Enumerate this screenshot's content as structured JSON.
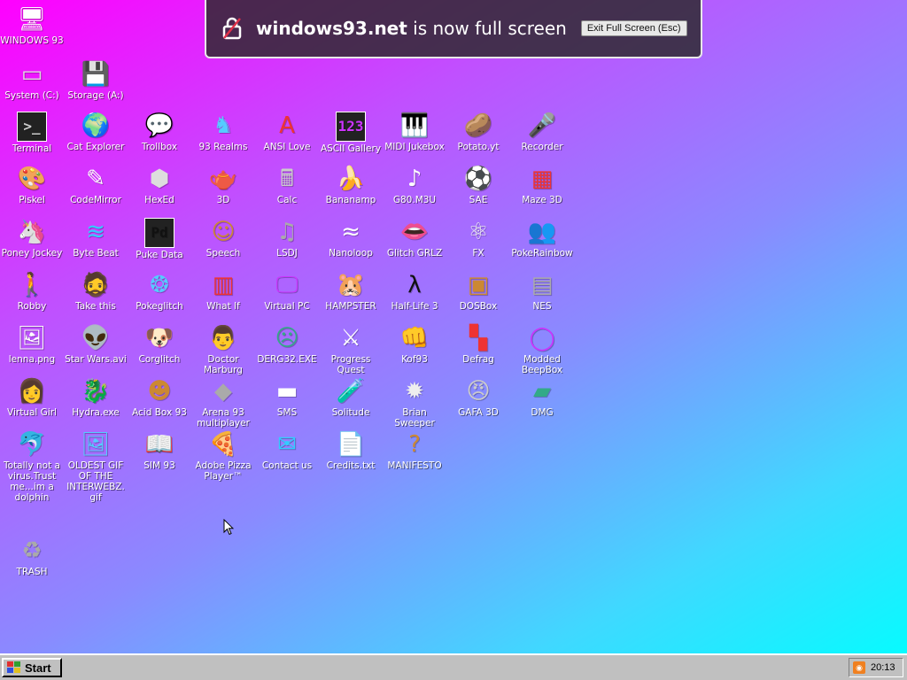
{
  "fullscreen_notice": {
    "site": "windows93.net",
    "message": " is now full screen",
    "exit_button": "Exit Full Screen (Esc)"
  },
  "taskbar": {
    "start_label": "Start",
    "clock": "20:13"
  },
  "desktop_icons": [
    {
      "label": "WINDOWS 93",
      "icon": "computer-icon",
      "glyph": "🖥"
    },
    {
      "label": "System (C:)",
      "icon": "hard-drive-icon",
      "glyph": "▭"
    },
    {
      "label": "Storage (A:)",
      "icon": "floppy-drive-icon",
      "glyph": "💾"
    },
    {
      "label": "Terminal",
      "icon": "terminal-icon",
      "glyph": ">_"
    },
    {
      "label": "Cat Explorer",
      "icon": "cat-globe-icon",
      "glyph": "🌍"
    },
    {
      "label": "Trollbox",
      "icon": "chat-bubble-icon",
      "glyph": "💬"
    },
    {
      "label": "93 Realms",
      "icon": "knight-icon",
      "glyph": "♞"
    },
    {
      "label": "ANSI Love",
      "icon": "ansi-pencil-icon",
      "glyph": "A"
    },
    {
      "label": "ASCII Gallery",
      "icon": "ascii-numbers-icon",
      "glyph": "123"
    },
    {
      "label": "MIDI Jukebox",
      "icon": "piano-keys-icon",
      "glyph": "🎹"
    },
    {
      "label": "Potato.yt",
      "icon": "potato-icon",
      "glyph": "🥔"
    },
    {
      "label": "Recorder",
      "icon": "microphone-icon",
      "glyph": "🎤"
    },
    {
      "label": "Piskel",
      "icon": "paint-palette-icon",
      "glyph": "🎨"
    },
    {
      "label": "CodeMirror",
      "icon": "code-mirror-icon",
      "glyph": "✎"
    },
    {
      "label": "HexEd",
      "icon": "cube-icon",
      "glyph": "⬢"
    },
    {
      "label": "3D",
      "icon": "teapot-icon",
      "glyph": "🫖"
    },
    {
      "label": "Calc",
      "icon": "calculator-icon",
      "glyph": "🖩"
    },
    {
      "label": "Bananamp",
      "icon": "banana-icon",
      "glyph": "🍌"
    },
    {
      "label": "G80.M3U",
      "icon": "playlist-file-icon",
      "glyph": "♪"
    },
    {
      "label": "SAE",
      "icon": "checkered-ball-icon",
      "glyph": "⚽"
    },
    {
      "label": "Maze 3D",
      "icon": "maze-icon",
      "glyph": "▦"
    },
    {
      "label": "Poney Jockey",
      "icon": "pony-icon",
      "glyph": "🦄"
    },
    {
      "label": "Byte Beat",
      "icon": "wave-icon",
      "glyph": "≋"
    },
    {
      "label": "Puke Data",
      "icon": "pd-icon",
      "glyph": "Pd"
    },
    {
      "label": "Speech",
      "icon": "face-icon",
      "glyph": "☺"
    },
    {
      "label": "LSDJ",
      "icon": "lsdj-icon",
      "glyph": "♫"
    },
    {
      "label": "Nanoloop",
      "icon": "loop-icon",
      "glyph": "≈"
    },
    {
      "label": "Glitch GRLZ",
      "icon": "lips-icon",
      "glyph": "👄"
    },
    {
      "label": "FX",
      "icon": "atom-icon",
      "glyph": "⚛"
    },
    {
      "label": "PokeRainbow",
      "icon": "characters-icon",
      "glyph": "👥"
    },
    {
      "label": "Robby",
      "icon": "stick-figure-icon",
      "glyph": "🚶"
    },
    {
      "label": "Take this",
      "icon": "pixel-man-icon",
      "glyph": "🧔"
    },
    {
      "label": "Pokeglitch",
      "icon": "glitch-icon",
      "glyph": "❂"
    },
    {
      "label": "What If",
      "icon": "grid-monitor-icon",
      "glyph": "▥"
    },
    {
      "label": "Virtual PC",
      "icon": "virtual-pc-icon",
      "glyph": "🖵"
    },
    {
      "label": "HAMPSTER",
      "icon": "hamster-icon",
      "glyph": "🐹"
    },
    {
      "label": "Half-Life 3",
      "icon": "lambda-icon",
      "glyph": "λ"
    },
    {
      "label": "DOSBox",
      "icon": "dosbox-icon",
      "glyph": "▣"
    },
    {
      "label": "NES",
      "icon": "nes-console-icon",
      "glyph": "▤"
    },
    {
      "label": "lenna.png",
      "icon": "image-file-icon",
      "glyph": "🖼"
    },
    {
      "label": "Star Wars.avi",
      "icon": "yoda-icon",
      "glyph": "👽"
    },
    {
      "label": "Corglitch",
      "icon": "corgi-icon",
      "glyph": "🐶"
    },
    {
      "label": "Doctor Marburg",
      "icon": "doctor-icon",
      "glyph": "👨"
    },
    {
      "label": "DERG32.EXE",
      "icon": "exe-face-icon",
      "glyph": "☹"
    },
    {
      "label": "Progress Quest",
      "icon": "crossed-swords-icon",
      "glyph": "⚔"
    },
    {
      "label": "Kof93",
      "icon": "fighter-icon",
      "glyph": "👊"
    },
    {
      "label": "Defrag",
      "icon": "defrag-icon",
      "glyph": "▚"
    },
    {
      "label": "Modded BeepBox",
      "icon": "green-ring-icon",
      "glyph": "◯"
    },
    {
      "label": "Virtual Girl",
      "icon": "girl-face-icon",
      "glyph": "👩"
    },
    {
      "label": "Hydra.exe",
      "icon": "hydra-icon",
      "glyph": "🐉"
    },
    {
      "label": "Acid Box 93",
      "icon": "smiley-icon",
      "glyph": "☻"
    },
    {
      "label": "Arena 93 multiplayer",
      "icon": "arena-cube-icon",
      "glyph": "◆"
    },
    {
      "label": "SMS",
      "icon": "console-icon",
      "glyph": "▬"
    },
    {
      "label": "Solitude",
      "icon": "bottle-icon",
      "glyph": "🧪"
    },
    {
      "label": "Brian Sweeper",
      "icon": "mine-icon",
      "glyph": "✹"
    },
    {
      "label": "GAFA 3D",
      "icon": "doom-face-icon",
      "glyph": "😠"
    },
    {
      "label": "DMG",
      "icon": "cartridge-icon",
      "glyph": "▰"
    },
    {
      "label": "Totally not a virus.Trust me...im a dolphin",
      "icon": "dolphin-icon",
      "glyph": "🐬"
    },
    {
      "label": "OLDEST GIF OF THE INTERWEBZ.gif",
      "icon": "gif-file-icon",
      "glyph": "🖼"
    },
    {
      "label": "SIM 93",
      "icon": "book-icon",
      "glyph": "📖"
    },
    {
      "label": "Adobe Pizza Player™",
      "icon": "pizza-icon",
      "glyph": "🍕"
    },
    {
      "label": "Contact us",
      "icon": "letter-icon",
      "glyph": "✉"
    },
    {
      "label": "Credits.txt",
      "icon": "text-file-icon",
      "glyph": "📄"
    },
    {
      "label": "MANIFESTO",
      "icon": "question-mark-icon",
      "glyph": "?"
    },
    {
      "label": "TRASH",
      "icon": "recycle-bin-icon",
      "glyph": "♻"
    }
  ]
}
